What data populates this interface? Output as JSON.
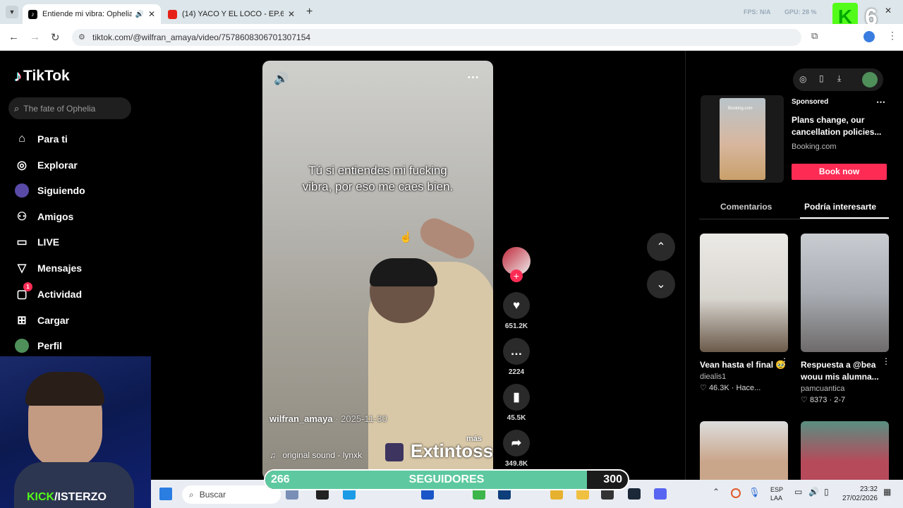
{
  "browser": {
    "tabs": [
      {
        "title": "Entiende mi vibra: Ophelia",
        "active": true
      },
      {
        "title": "(14) YACO Y EL LOCO - EP.6 - [",
        "active": false
      }
    ],
    "url": "tiktok.com/@wilfran_amaya/video/7578608306701307154",
    "overlay_text": {
      "fps": "FPS: N/A",
      "gpu": "GPU: 28 %"
    }
  },
  "sidebar": {
    "logo": "TikTok",
    "search_placeholder": "The fate of Ophelia",
    "items": [
      {
        "label": "Para ti",
        "icon": "home-icon"
      },
      {
        "label": "Explorar",
        "icon": "compass-icon"
      },
      {
        "label": "Siguiendo",
        "icon": "following-icon"
      },
      {
        "label": "Amigos",
        "icon": "friends-icon"
      },
      {
        "label": "LIVE",
        "icon": "live-icon"
      },
      {
        "label": "Mensajes",
        "icon": "send-icon"
      },
      {
        "label": "Actividad",
        "icon": "inbox-icon",
        "badge": "1"
      },
      {
        "label": "Cargar",
        "icon": "upload-icon"
      },
      {
        "label": "Perfil",
        "icon": "avatar-icon"
      }
    ]
  },
  "video": {
    "subtitle_line1": "Tú si entiendes mi fucking",
    "subtitle_line2": "vibra, por eso me caes bien.",
    "author": "wilfran_amaya",
    "date": "· 2025-11-30",
    "more": "más",
    "sound": "original sound - lynxk",
    "watermark": "Extintoss"
  },
  "actions": {
    "likes": "651.2K",
    "comments": "2224",
    "saves": "45.5K",
    "shares": "349.8K"
  },
  "ad": {
    "sponsored": "Sponsored",
    "title": "Plans change, our cancellation policies...",
    "brand": "Booking.com",
    "cta": "Book now",
    "thumb_brand": "Booking.com"
  },
  "right_tabs": {
    "comments": "Comentarios",
    "suggested": "Podría interesarte"
  },
  "suggested": [
    {
      "caption": "Vean hasta el final 🥹",
      "author": "diealis1",
      "likes": "46.3K",
      "time": "· Hace..."
    },
    {
      "caption": "Respuesta a @bea wouu mis alumna...",
      "author": "pamcuantica",
      "likes": "8373",
      "time": "· 2-7"
    }
  ],
  "stream": {
    "platform": "KICK",
    "streamer": "/ISTERZO",
    "corner_number": "6",
    "followers_current": "266",
    "followers_label": "SEGUIDORES",
    "followers_goal": "300",
    "followers_progress": 0.887
  },
  "taskbar": {
    "search": "Buscar",
    "lang_line1": "ESP",
    "lang_line2": "LAA",
    "time": "23:32",
    "date": "27/02/2026"
  },
  "colors": {
    "tiktok_red": "#fe2c55",
    "progress_fill": "#5ec9a0",
    "kick_green": "#53fc18"
  }
}
